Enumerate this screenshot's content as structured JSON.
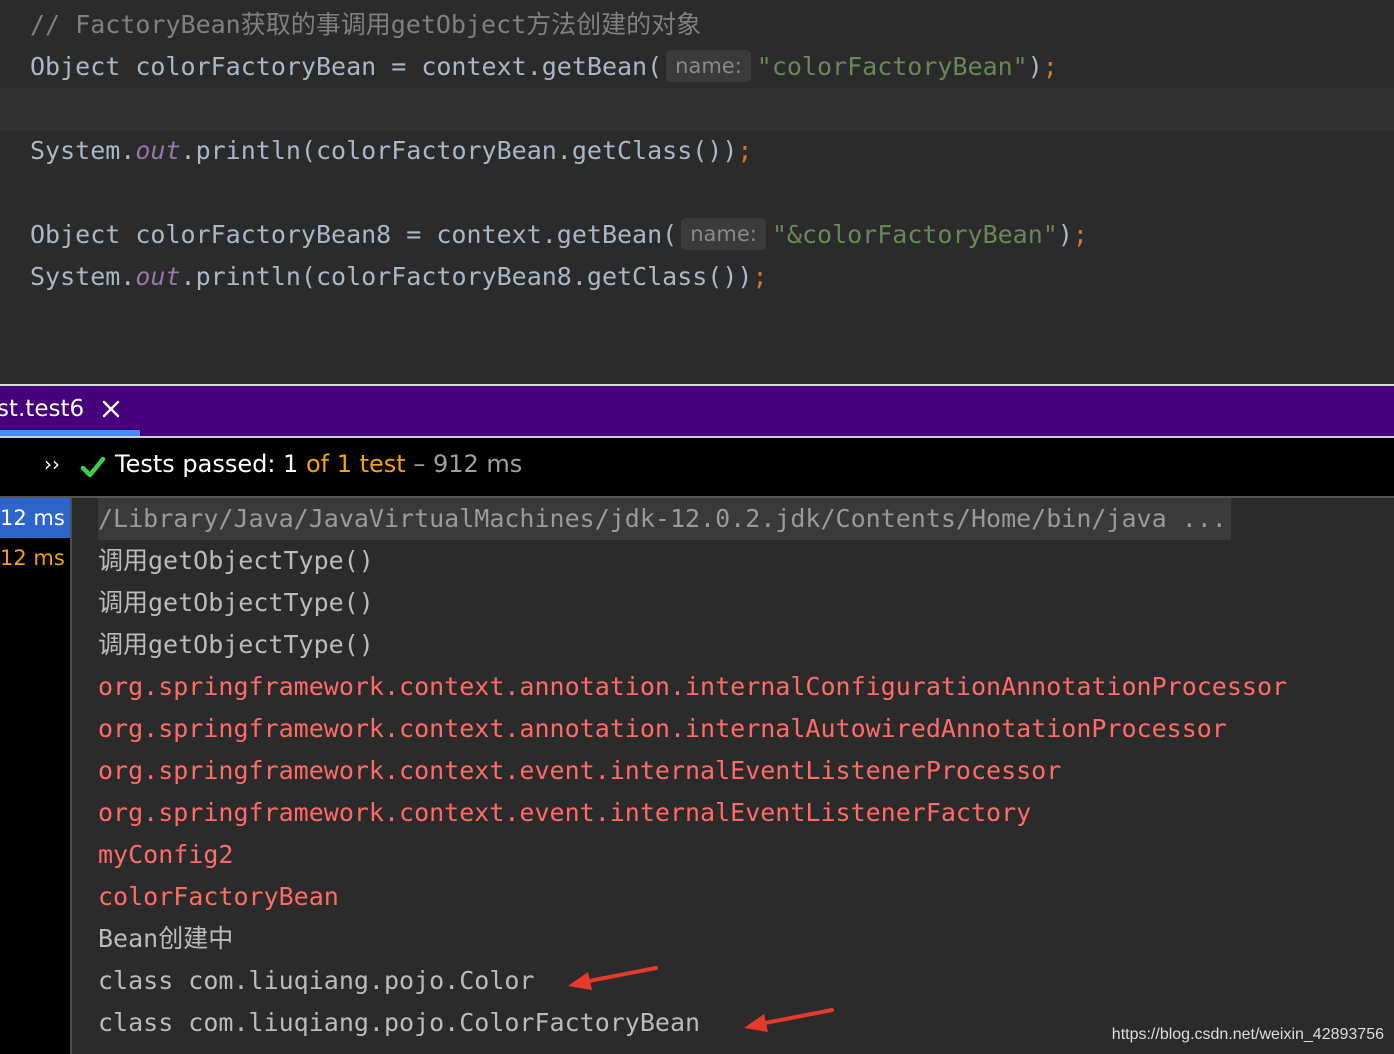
{
  "editor": {
    "comment": "// FactoryBean获取的事调用getObject方法创建的对象",
    "line1": {
      "decl": "Object colorFactoryBean = context.getBean(",
      "hint": "name:",
      "arg": "\"colorFactoryBean\"",
      "close": ")",
      "semi": ";"
    },
    "line3": {
      "prefix": "System.",
      "field": "out",
      "call": ".println(colorFactoryBean.getClass())",
      "semi": ";"
    },
    "line5": {
      "decl": "Object colorFactoryBean8 = context.getBean(",
      "hint": "name:",
      "arg": "\"&colorFactoryBean\"",
      "close": ")",
      "semi": ";"
    },
    "line6": {
      "prefix": "System.",
      "field": "out",
      "call": ".println(colorFactoryBean8.getClass())",
      "semi": ";"
    }
  },
  "run_panel": {
    "tab_label": "st.test6",
    "status": {
      "passed": "Tests passed: 1",
      "of": " of 1 test",
      "duration": " – 912 ms"
    },
    "tree": [
      {
        "label": "12 ms",
        "selected": true
      },
      {
        "label": "12 ms",
        "selected": false
      }
    ],
    "console": {
      "command": "/Library/Java/JavaVirtualMachines/jdk-12.0.2.jdk/Contents/Home/bin/java ...",
      "lines": [
        {
          "text": "调用getObjectType()",
          "kind": "normal"
        },
        {
          "text": "调用getObjectType()",
          "kind": "normal"
        },
        {
          "text": "调用getObjectType()",
          "kind": "normal"
        },
        {
          "text": "org.springframework.context.annotation.internalConfigurationAnnotationProcessor",
          "kind": "err"
        },
        {
          "text": "org.springframework.context.annotation.internalAutowiredAnnotationProcessor",
          "kind": "err"
        },
        {
          "text": "org.springframework.context.event.internalEventListenerProcessor",
          "kind": "err"
        },
        {
          "text": "org.springframework.context.event.internalEventListenerFactory",
          "kind": "err"
        },
        {
          "text": "myConfig2",
          "kind": "err"
        },
        {
          "text": "colorFactoryBean",
          "kind": "err"
        },
        {
          "text": "Bean创建中",
          "kind": "normal"
        },
        {
          "text": "class com.liuqiang.pojo.Color",
          "kind": "normal"
        },
        {
          "text": "class com.liuqiang.pojo.ColorFactoryBean",
          "kind": "normal"
        }
      ]
    }
  },
  "watermark": "https://blog.csdn.net/weixin_42893756",
  "colors": {
    "accent_purple": "#46007c",
    "selection_blue": "#2e65ca",
    "error_red": "#ff6b68",
    "pass_green": "#3ccf4e",
    "annotation_red": "#e8392c"
  },
  "icons": {
    "run_expand": "chevron-double-right-icon",
    "tab_close": "close-icon",
    "status": "check-icon",
    "annotation": "red-arrow-icon"
  }
}
